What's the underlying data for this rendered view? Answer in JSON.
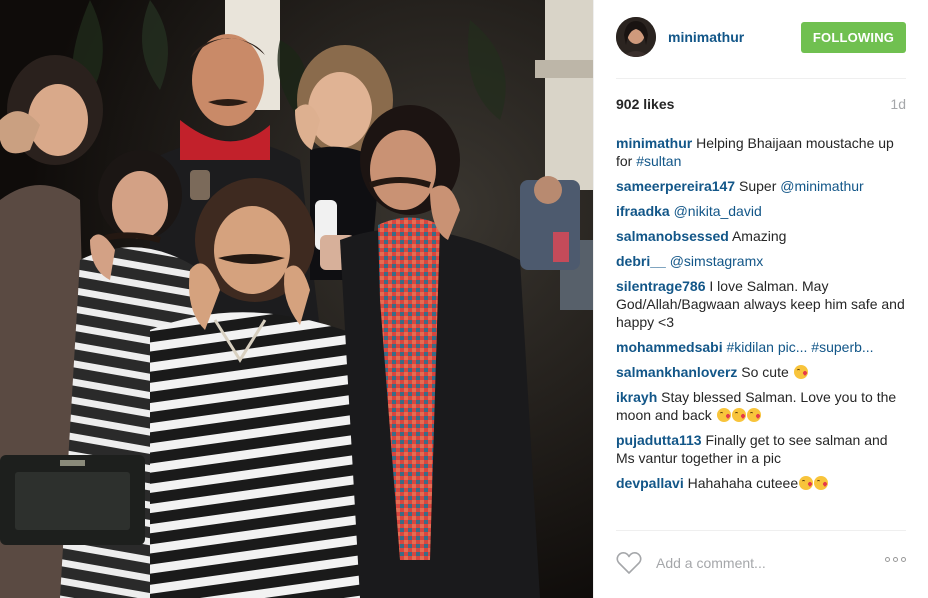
{
  "header": {
    "username": "minimathur",
    "follow_label": "FOLLOWING"
  },
  "post": {
    "likes": "902 likes",
    "age": "1d"
  },
  "caption": {
    "user": "minimathur",
    "text": "Helping Bhaijaan moustache up for ",
    "hashtag": "#sultan"
  },
  "comments": [
    {
      "user": "sameerpereira147",
      "text": "Super ",
      "mention": "@minimathur"
    },
    {
      "user": "ifraadka",
      "text": "",
      "mention": "@nikita_david"
    },
    {
      "user": "salmanobsessed",
      "text": "Amazing",
      "mention": ""
    },
    {
      "user": "debri__",
      "text": "",
      "mention": "@simstagramx"
    },
    {
      "user": "silentrage786",
      "text": "I love Salman. May God/Allah/Bagwaan always keep him safe and happy <3",
      "mention": ""
    },
    {
      "user": "mohammedsabi",
      "text": "",
      "mention": "#kidilan pic... #superb..."
    },
    {
      "user": "salmankhanloverz",
      "text": "So cute ",
      "mention": "",
      "emoji_count": 1
    },
    {
      "user": "ikrayh",
      "text": "Stay blessed Salman. Love you to the moon and back ",
      "mention": "",
      "emoji_count": 3
    },
    {
      "user": "pujadutta113",
      "text": "Finally get to see salman and Ms vantur together in a pic",
      "mention": ""
    },
    {
      "user": "devpallavi",
      "text": "Hahahaha cuteee",
      "mention": "",
      "emoji_count": 2
    }
  ],
  "add_comment": {
    "placeholder": "Add a comment..."
  },
  "icons": {
    "like": "heart-outline-icon",
    "more": "more-options-icon",
    "emoji": "kissing-face-emoji"
  },
  "colors": {
    "link": "#125688",
    "follow_button": "#70c050",
    "meta_grey": "#a5a7aa",
    "text": "#262626"
  }
}
